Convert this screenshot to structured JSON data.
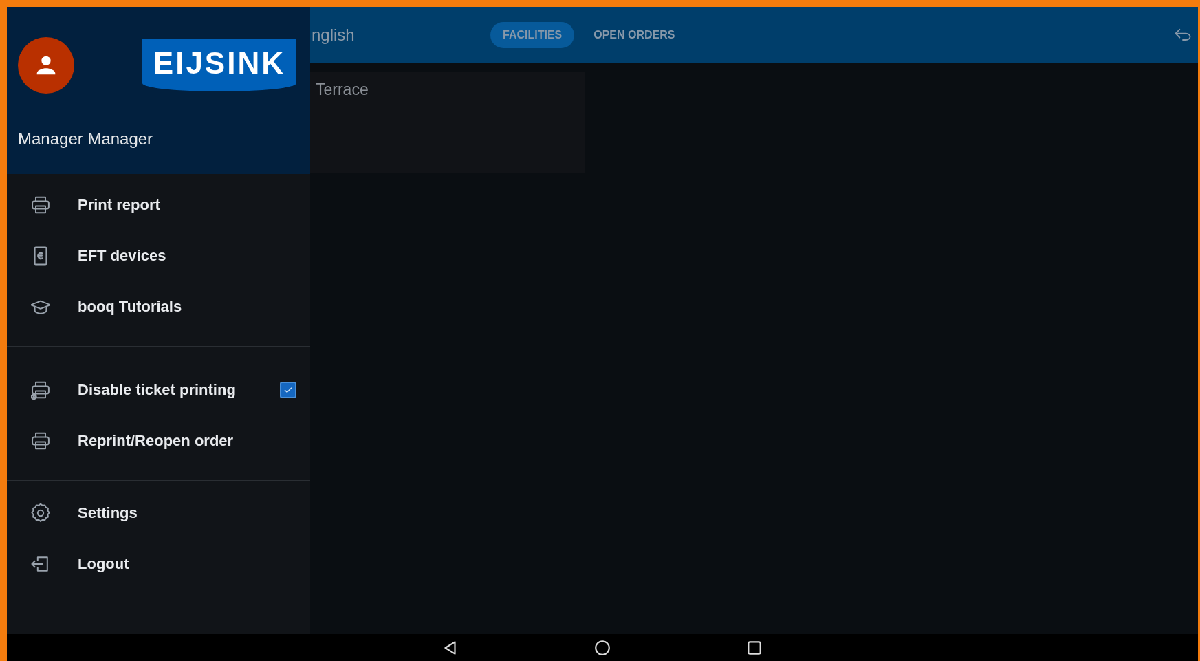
{
  "topbar": {
    "title": "nglish",
    "tabs": [
      {
        "label": "FACILITIES",
        "selected": true
      },
      {
        "label": "OPEN ORDERS",
        "selected": false
      }
    ]
  },
  "facilities": [
    {
      "name": "Terrace"
    }
  ],
  "drawer": {
    "logo": "EIJSINK",
    "user": "Manager Manager",
    "sections": [
      [
        {
          "kind": "action",
          "label": "Print report"
        },
        {
          "kind": "action",
          "label": "EFT devices"
        },
        {
          "kind": "action",
          "label": "booq Tutorials"
        }
      ],
      [
        {
          "kind": "checkbox",
          "label": "Disable ticket printing",
          "checked": true
        },
        {
          "kind": "action",
          "label": "Reprint/Reopen order"
        }
      ],
      [
        {
          "kind": "action",
          "label": "Settings"
        },
        {
          "kind": "action",
          "label": "Logout"
        }
      ]
    ]
  }
}
